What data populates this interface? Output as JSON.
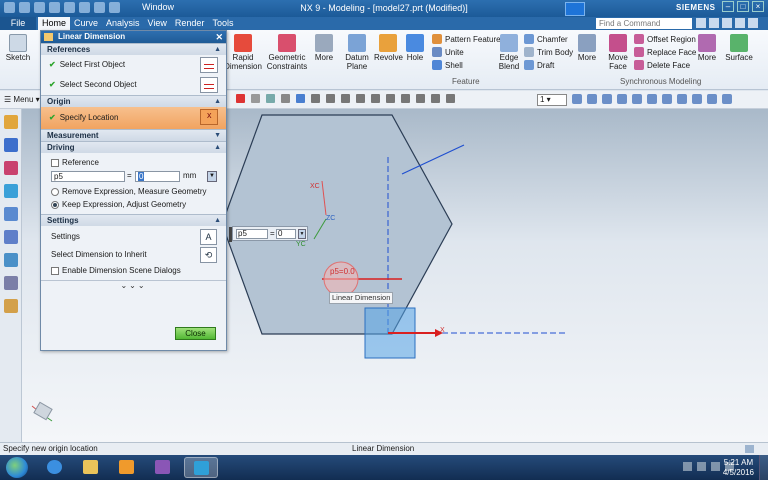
{
  "titlebar": {
    "window_menu": "Window",
    "title": "NX 9 - Modeling - [model27.prt (Modified)]",
    "brand": "SIEMENS"
  },
  "menubar": {
    "file": "File",
    "tabs": [
      "Home",
      "Curve",
      "Analysis",
      "View",
      "Render",
      "Tools"
    ],
    "active_tab": "Home",
    "find_placeholder": "Find a Command"
  },
  "ribbon": {
    "sketch": "Sketch",
    "rapid_dimension": [
      "Rapid",
      "Dimension"
    ],
    "geometric_constraints": [
      "Geometric",
      "Constraints"
    ],
    "more1": "More",
    "datum_plane": [
      "Datum",
      "Plane"
    ],
    "revolve": "Revolve",
    "hole": "Hole",
    "pattern_feature": "Pattern Feature",
    "unite": "Unite",
    "shell": "Shell",
    "edge_blend": [
      "Edge",
      "Blend"
    ],
    "chamfer": "Chamfer",
    "trim_body": "Trim Body",
    "draft": "Draft",
    "more2": "More",
    "move_face": [
      "Move",
      "Face"
    ],
    "offset_region": "Offset Region",
    "replace_face": "Replace Face",
    "delete_face": "Delete Face",
    "more3": "More",
    "surface": "Surface",
    "group_feature": "Feature",
    "group_sync": "Synchronous Modeling"
  },
  "seltoolbar": {
    "menu": "Menu",
    "layer_value": "1"
  },
  "dialog": {
    "title": "Linear Dimension",
    "references": "References",
    "select_first": "Select First Object",
    "select_second": "Select Second Object",
    "origin": "Origin",
    "specify_location": "Specify Location",
    "measurement": "Measurement",
    "driving": "Driving",
    "reference_label": "Reference",
    "expr_name": "p5",
    "expr_eq": "=",
    "expr_value": "0",
    "expr_unit": "mm",
    "opt_remove": "Remove Expression, Measure Geometry",
    "opt_keep": "Keep Expression, Adjust Geometry",
    "settings_header": "Settings",
    "settings_label": "Settings",
    "select_inherit": "Select Dimension to Inherit",
    "enable_scene": "Enable Dimension Scene Dialogs",
    "more_chevrons": "⌄⌄⌄",
    "close": "Close"
  },
  "osi": {
    "name": "p5",
    "eq": "=",
    "value": "0"
  },
  "canvas": {
    "tooltip": "Linear Dimension",
    "xc": "XC",
    "yc": "YC",
    "zc": "ZC",
    "x_axis": "X",
    "dim_text": "p5=0.0"
  },
  "statusbar": {
    "left": "Specify new origin location",
    "middle": "Linear Dimension"
  },
  "taskbar": {
    "time": "5:21 AM",
    "date": "4/5/2016"
  },
  "colors": {
    "accent": "#2a6aaa",
    "active_row": "#f1a360",
    "close_button": "#52b834",
    "sketch_blue": "#1f4fd0",
    "cursor_red": "#d92020"
  }
}
